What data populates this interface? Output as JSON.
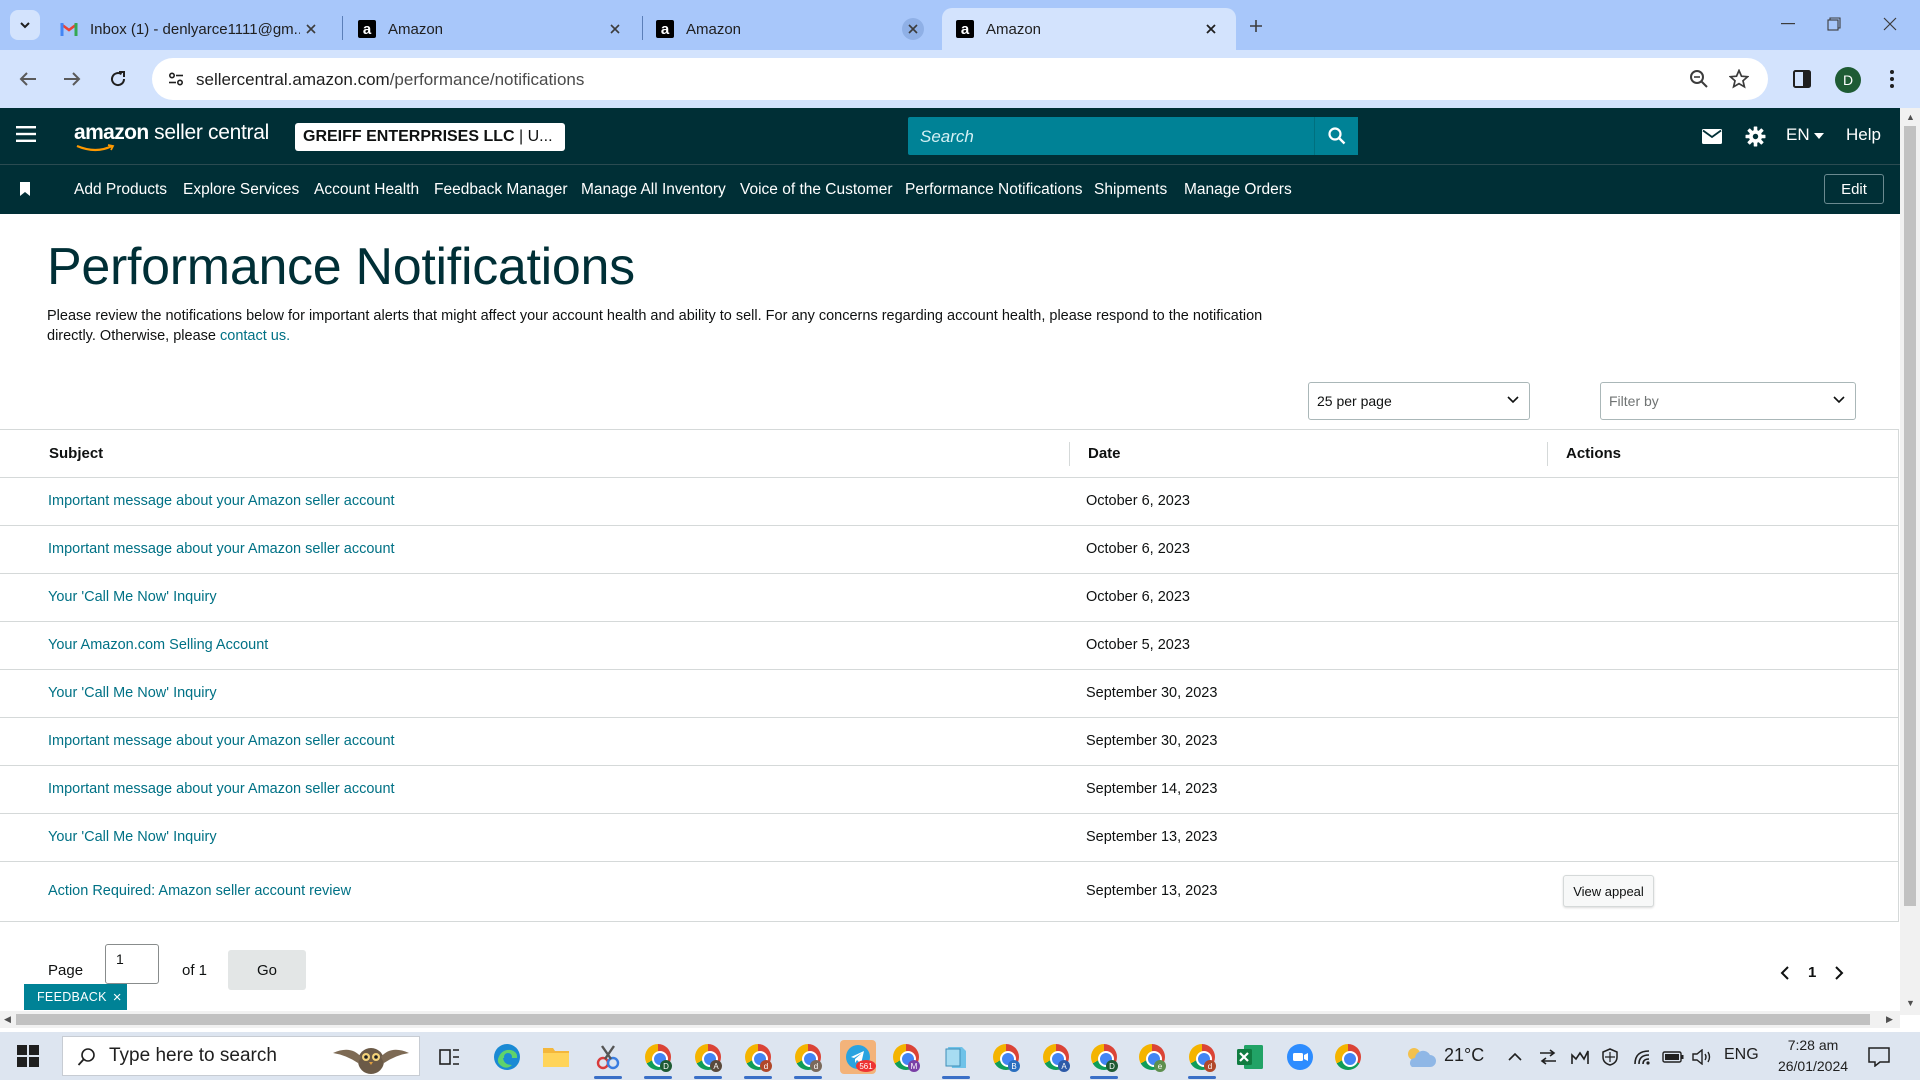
{
  "browser": {
    "tabs": [
      {
        "title": "Inbox (1) - denlyarce1111@gm...",
        "favicon": "gmail-icon",
        "active": false
      },
      {
        "title": "Amazon",
        "favicon": "amazon-icon",
        "active": false
      },
      {
        "title": "Amazon",
        "favicon": "amazon-icon",
        "active": false
      },
      {
        "title": "Amazon",
        "favicon": "amazon-icon",
        "active": true
      }
    ],
    "url_host": "sellercentral.amazon.com",
    "url_path": "/performance/notifications",
    "profile_initial": "D"
  },
  "header": {
    "logo_brand": "amazon",
    "logo_rest": " seller central",
    "account_name": "GREIFF ENTERPRISES LLC",
    "account_marketplace": " | U...",
    "search_placeholder": "Search",
    "language": "EN",
    "help": "Help"
  },
  "nav": {
    "items": [
      "Add Products",
      "Explore Services",
      "Account Health",
      "Feedback Manager",
      "Manage All Inventory",
      "Voice of the Customer",
      "Performance Notifications",
      "Shipments",
      "Manage Orders"
    ],
    "edit_label": "Edit"
  },
  "page": {
    "title": "Performance Notifications",
    "intro_text": "Please review the notifications below for important alerts that might affect your account health and ability to sell. For any concerns regarding account health, please respond to the notification directly. Otherwise, please ",
    "contact_link": "contact us.",
    "per_page_value": "25 per page",
    "filter_placeholder": "Filter by"
  },
  "table": {
    "headers": {
      "subject": "Subject",
      "date": "Date",
      "actions": "Actions"
    },
    "rows": [
      {
        "subject": "Important message about your Amazon seller account",
        "date": "October 6, 2023",
        "action": ""
      },
      {
        "subject": "Important message about your Amazon seller account",
        "date": "October 6, 2023",
        "action": ""
      },
      {
        "subject": "Your 'Call Me Now' Inquiry",
        "date": "October 6, 2023",
        "action": ""
      },
      {
        "subject": "Your Amazon.com Selling Account",
        "date": "October 5, 2023",
        "action": ""
      },
      {
        "subject": "Your 'Call Me Now' Inquiry",
        "date": "September 30, 2023",
        "action": ""
      },
      {
        "subject": "Important message about your Amazon seller account",
        "date": "September 30, 2023",
        "action": ""
      },
      {
        "subject": "Important message about your Amazon seller account",
        "date": "September 14, 2023",
        "action": ""
      },
      {
        "subject": "Your 'Call Me Now' Inquiry",
        "date": "September 13, 2023",
        "action": ""
      },
      {
        "subject": "Action Required: Amazon seller account review",
        "date": "September 13, 2023",
        "action": "View appeal"
      }
    ]
  },
  "pagination": {
    "page_label": "Page",
    "current_page": "1",
    "of_label": "of 1",
    "go_label": "Go",
    "page_number": "1"
  },
  "feedback": {
    "label": "FEEDBACK",
    "close": "×"
  },
  "taskbar": {
    "search_placeholder": "Type here to search",
    "weather": "21°C",
    "language": "ENG",
    "time": "7:28 am",
    "date": "26/01/2024",
    "telegram_badge": "561"
  },
  "colors": {
    "header_bg": "#002f36",
    "search_bg": "#008296",
    "link": "#007185",
    "title": "#002f36"
  }
}
